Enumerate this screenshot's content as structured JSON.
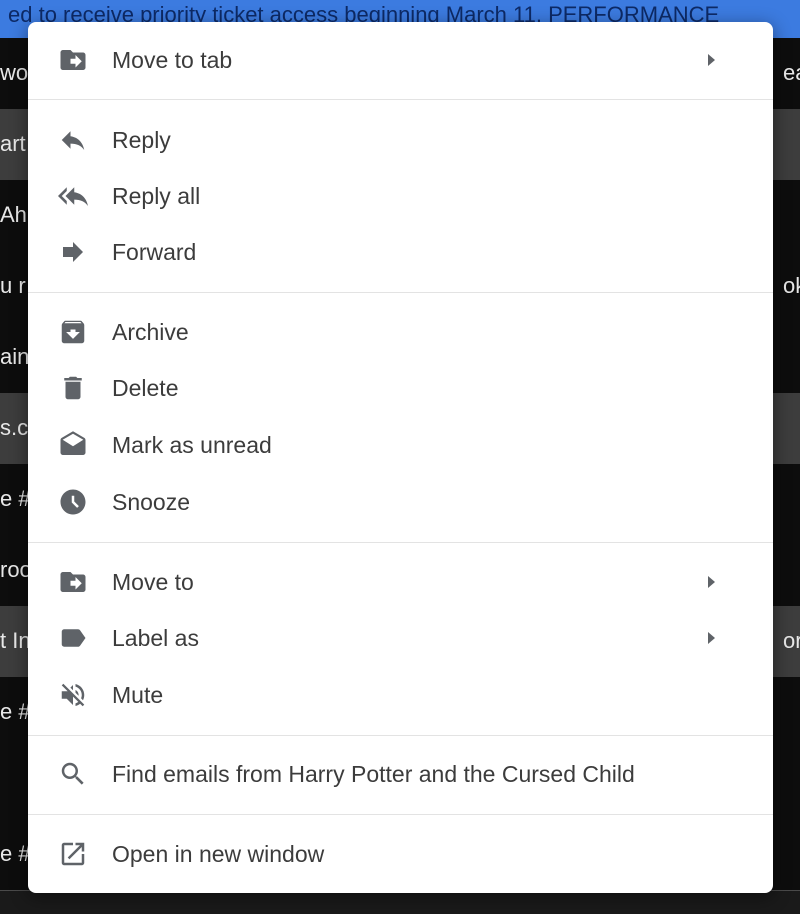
{
  "background": {
    "banner_text": "ed to receive priority ticket access beginning March 11. PERFORMANCE",
    "rows": [
      {
        "left": "wo",
        "right": "ear"
      },
      {
        "left": "art",
        "right": ""
      },
      {
        "left": "Ah",
        "right": ""
      },
      {
        "left": "u r",
        "right": "ok"
      },
      {
        "left": "ain",
        "right": ""
      },
      {
        "left": "s.c",
        "right": ""
      },
      {
        "left": "e #",
        "right": ""
      },
      {
        "left": "roo",
        "right": ""
      },
      {
        "left": "t In",
        "right": "ore"
      },
      {
        "left": "e #",
        "right": ""
      },
      {
        "left": "",
        "right": ""
      },
      {
        "left": "e #",
        "right": ""
      }
    ]
  },
  "menu": {
    "items": [
      {
        "label": "Move to tab",
        "icon": "move-to-tab-icon",
        "submenu": true
      },
      {
        "label": "Reply",
        "icon": "reply-icon",
        "submenu": false
      },
      {
        "label": "Reply all",
        "icon": "reply-all-icon",
        "submenu": false
      },
      {
        "label": "Forward",
        "icon": "forward-icon",
        "submenu": false
      },
      {
        "label": "Archive",
        "icon": "archive-icon",
        "submenu": false
      },
      {
        "label": "Delete",
        "icon": "trash-icon",
        "submenu": false
      },
      {
        "label": "Mark as unread",
        "icon": "mark-unread-icon",
        "submenu": false
      },
      {
        "label": "Snooze",
        "icon": "clock-icon",
        "submenu": false
      },
      {
        "label": "Move to",
        "icon": "move-to-icon",
        "submenu": true
      },
      {
        "label": "Label as",
        "icon": "label-icon",
        "submenu": true
      },
      {
        "label": "Mute",
        "icon": "mute-icon",
        "submenu": false
      },
      {
        "label": "Find emails from Harry Potter and the Cursed Child",
        "icon": "search-icon",
        "submenu": false
      },
      {
        "label": "Open in new window",
        "icon": "open-in-new-icon",
        "submenu": false
      }
    ]
  },
  "colors": {
    "icon": "#5f6368",
    "text": "#3c3c3c",
    "banner": "#3c7be0"
  }
}
